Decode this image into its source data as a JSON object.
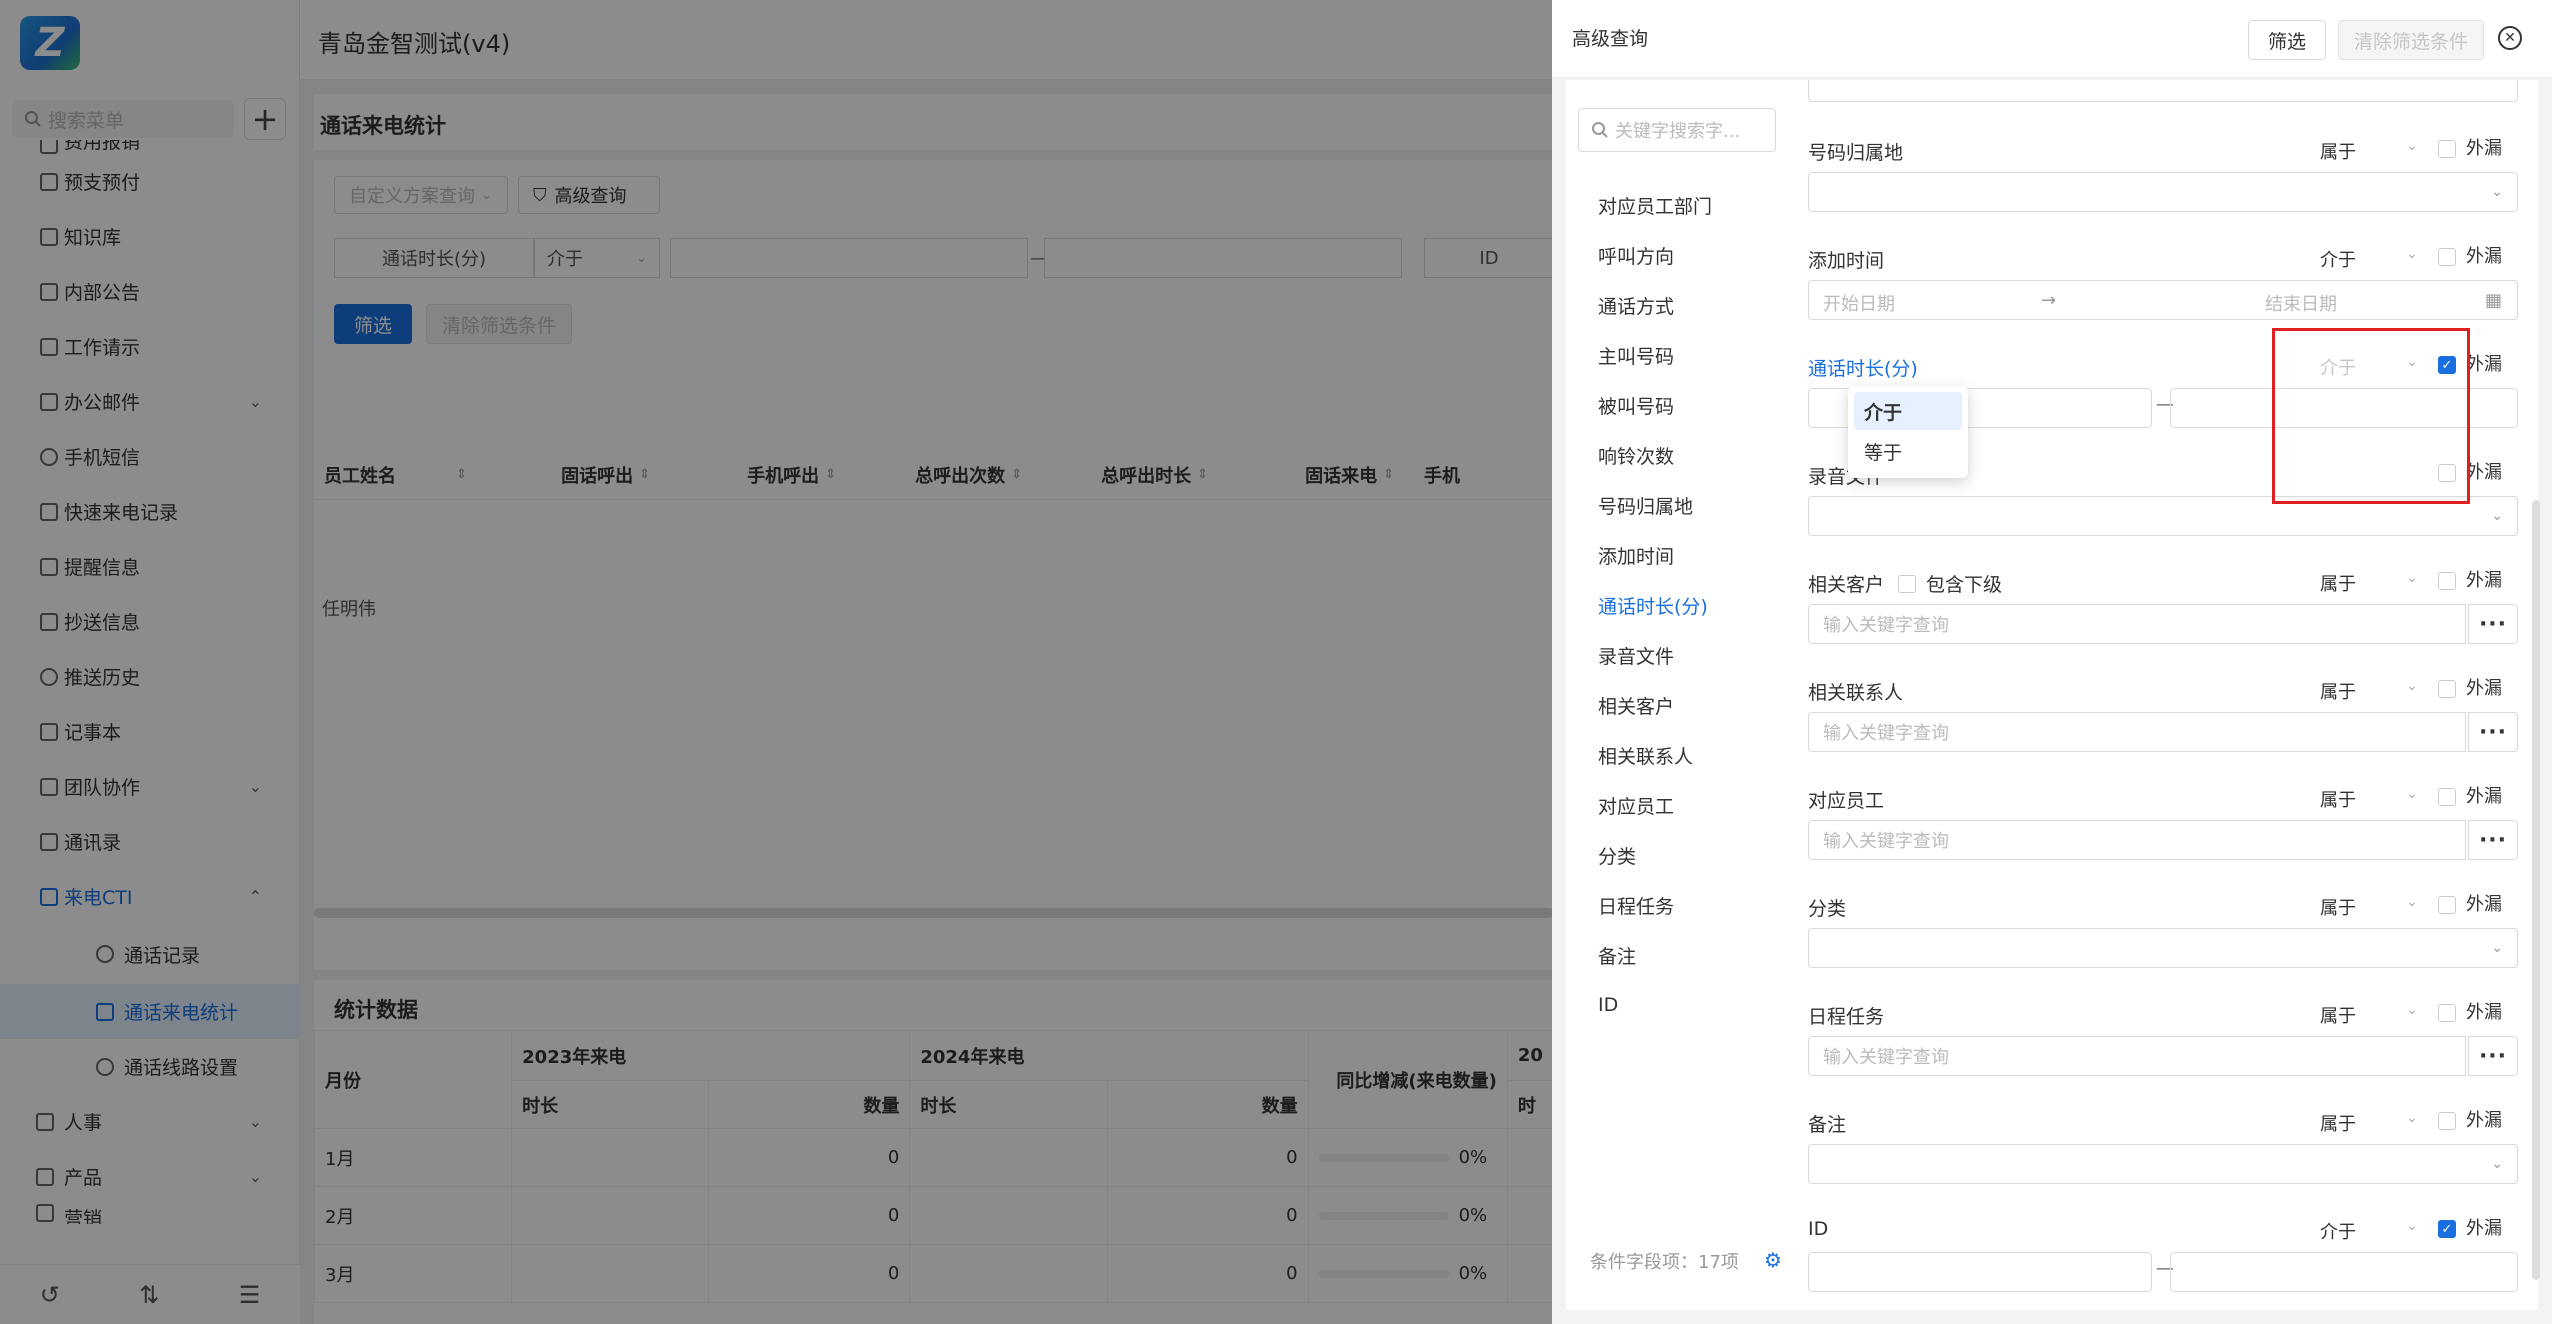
{
  "app": {
    "title": "青岛金智测试(v4)"
  },
  "sidebar": {
    "search_placeholder": "搜索菜单",
    "items": [
      {
        "label": "费用报销"
      },
      {
        "label": "预支预付"
      },
      {
        "label": "知识库"
      },
      {
        "label": "内部公告"
      },
      {
        "label": "工作请示"
      },
      {
        "label": "办公邮件",
        "chevron": "⌄"
      },
      {
        "label": "手机短信"
      },
      {
        "label": "快速来电记录"
      },
      {
        "label": "提醒信息"
      },
      {
        "label": "抄送信息"
      },
      {
        "label": "推送历史"
      },
      {
        "label": "记事本"
      },
      {
        "label": "团队协作",
        "chevron": "⌄"
      },
      {
        "label": "通讯录"
      },
      {
        "label": "来电CTI",
        "chevron": "⌃"
      }
    ],
    "subitems": [
      {
        "label": "通话记录"
      },
      {
        "label": "通话来电统计"
      },
      {
        "label": "通话线路设置"
      }
    ],
    "groups": [
      {
        "label": "人事",
        "chevron": "⌄"
      },
      {
        "label": "产品",
        "chevron": "⌄"
      },
      {
        "label": "营销",
        "chevron": "⌄"
      }
    ]
  },
  "page": {
    "title": "通话来电统计",
    "scheme_placeholder": "自定义方案查询",
    "advanced_btn": "高级查询",
    "filter_field": "通话时长(分)",
    "filter_op": "介于",
    "filter_dash": "—",
    "filter_id": "ID",
    "btn_filter": "筛选",
    "btn_clear": "清除筛选条件",
    "columns": [
      "员工姓名",
      "固话呼出",
      "手机呼出",
      "总呼出次数",
      "总呼出时长",
      "固话来电",
      "手机"
    ],
    "row_name": "任明伟"
  },
  "stats": {
    "title": "统计数据",
    "col_month": "月份",
    "year1": "2023年来电",
    "year2": "2024年来电",
    "yoy": "同比增减(来电数量)",
    "cut": "20",
    "sub_dur": "时长",
    "sub_cnt": "数量",
    "sub_cut": "时",
    "rows": [
      {
        "m": "1月",
        "c1": "0",
        "c2": "0",
        "p": "0%"
      },
      {
        "m": "2月",
        "c1": "0",
        "c2": "0",
        "p": "0%"
      },
      {
        "m": "3月",
        "c1": "0",
        "c2": "0",
        "p": "0%"
      }
    ]
  },
  "drawer": {
    "title": "高级查询",
    "btn_filter": "筛选",
    "btn_clear": "清除筛选条件",
    "search_placeholder": "关键字搜索字...",
    "fields": [
      "对应员工部门",
      "呼叫方向",
      "通话方式",
      "主叫号码",
      "被叫号码",
      "响铃次数",
      "号码归属地",
      "添加时间",
      "通话时长(分)",
      "录音文件",
      "相关客户",
      "相关联系人",
      "对应员工",
      "分类",
      "日程任务",
      "备注",
      "ID"
    ],
    "footer": "条件字段项：17项",
    "rows": {
      "r1": {
        "label": "号码归属地",
        "op": "属于",
        "cb": "外漏"
      },
      "r2": {
        "label": "添加时间",
        "op": "介于",
        "cb": "外漏",
        "start": "开始日期",
        "arrow": "→",
        "end": "结束日期"
      },
      "r3": {
        "label": "通话时长(分)",
        "op": "介于",
        "cb": "外漏",
        "dash": "—"
      },
      "r4": {
        "label": "录音文件",
        "cb": "外漏"
      },
      "r5": {
        "label": "相关客户",
        "sub": "包含下级",
        "op": "属于",
        "cb": "外漏",
        "ph": "输入关键字查询"
      },
      "r6": {
        "label": "相关联系人",
        "op": "属于",
        "cb": "外漏",
        "ph": "输入关键字查询"
      },
      "r7": {
        "label": "对应员工",
        "op": "属于",
        "cb": "外漏",
        "ph": "输入关键字查询"
      },
      "r8": {
        "label": "分类",
        "op": "属于",
        "cb": "外漏"
      },
      "r9": {
        "label": "日程任务",
        "op": "属于",
        "cb": "外漏",
        "ph": "输入关键字查询"
      },
      "r10": {
        "label": "备注",
        "op": "属于",
        "cb": "外漏"
      },
      "r11": {
        "label": "ID",
        "op": "介于",
        "cb": "外漏",
        "dash": "—"
      }
    },
    "dots": "···",
    "dropdown": [
      "介于",
      "等于"
    ]
  },
  "colors": {
    "accent": "#1a6fe0",
    "highlight": "#e02020"
  }
}
